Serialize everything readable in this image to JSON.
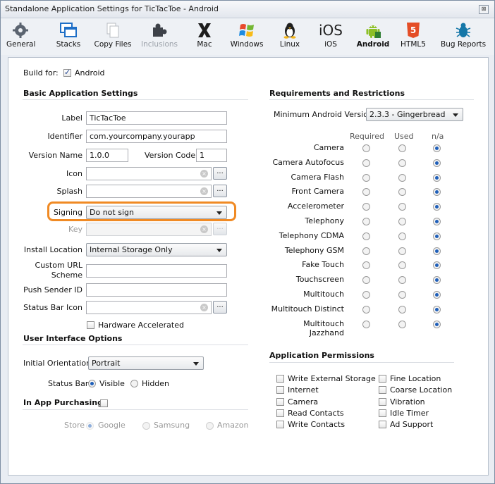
{
  "window": {
    "title": "Standalone Application Settings for TicTacToe - Android",
    "close": "⊠"
  },
  "toolbar": [
    {
      "label": "General",
      "icon": "gear-icon",
      "state": "normal"
    },
    {
      "label": "Stacks",
      "icon": "stacks-icon",
      "state": "normal"
    },
    {
      "label": "Copy Files",
      "icon": "copy-files-icon",
      "state": "normal"
    },
    {
      "label": "Inclusions",
      "icon": "puzzle-icon",
      "state": "disabled"
    },
    {
      "label": "Mac",
      "icon": "mac-x-icon",
      "state": "normal"
    },
    {
      "label": "Windows",
      "icon": "windows-logo-icon",
      "state": "normal"
    },
    {
      "label": "Linux",
      "icon": "penguin-icon",
      "state": "normal"
    },
    {
      "label": "iOS",
      "icon": "ios-icon",
      "state": "normal",
      "icon_text": "iOS"
    },
    {
      "label": "Android",
      "icon": "android-icon",
      "state": "selected"
    },
    {
      "label": "HTML5",
      "icon": "html5-icon",
      "state": "normal",
      "icon_text": "5"
    },
    {
      "label": "Bug Reports",
      "icon": "bug-icon",
      "state": "normal"
    }
  ],
  "build_for": {
    "label": "Build for:",
    "option": "Android",
    "checked": true
  },
  "basic": {
    "heading": "Basic Application Settings",
    "label_label": "Label",
    "label_value": "TicTacToe",
    "identifier_label": "Identifier",
    "identifier_value": "com.yourcompany.yourapp",
    "version_name_label": "Version Name",
    "version_name_value": "1.0.0",
    "version_code_label": "Version Code",
    "version_code_value": "1",
    "icon_label": "Icon",
    "splash_label": "Splash",
    "signing_label": "Signing",
    "signing_value": "Do not sign",
    "key_label": "Key",
    "install_location_label": "Install Location",
    "install_location_value": "Internal Storage Only",
    "custom_url_label_1": "Custom URL",
    "custom_url_label_2": "Scheme",
    "push_sender_label": "Push Sender ID",
    "status_bar_icon_label": "Status Bar Icon",
    "hardware_accel_label": "Hardware Accelerated",
    "browse": "..."
  },
  "ui_options": {
    "heading": "User Interface Options",
    "orientation_label": "Initial Orientation",
    "orientation_value": "Portrait",
    "status_bar_label": "Status Bar",
    "visible": "Visible",
    "hidden": "Hidden"
  },
  "in_app": {
    "heading": "In App Purchasing",
    "store_label": "Store",
    "google": "Google",
    "samsung": "Samsung",
    "amazon": "Amazon"
  },
  "requirements": {
    "heading": "Requirements and Restrictions",
    "min_version_label": "Minimum Android Version",
    "min_version_value": "2.3.3 - Gingerbread",
    "col_required": "Required",
    "col_used": "Used",
    "col_na": "n/a",
    "rows": [
      "Camera",
      "Camera Autofocus",
      "Camera Flash",
      "Front Camera",
      "Accelerometer",
      "Telephony",
      "Telephony CDMA",
      "Telephony GSM",
      "Fake Touch",
      "Touchscreen",
      "Multitouch",
      "Multitouch Distinct",
      "Multitouch Jazzhand"
    ],
    "selected": "n/a"
  },
  "permissions": {
    "heading": "Application Permissions",
    "left": [
      "Write External Storage",
      "Internet",
      "Camera",
      "Read Contacts",
      "Write Contacts"
    ],
    "right": [
      "Fine Location",
      "Coarse Location",
      "Vibration",
      "Idle Timer",
      "Ad Support"
    ]
  },
  "colors": {
    "highlight": "#f08a24",
    "radio_selected": "#1f5fb9"
  }
}
